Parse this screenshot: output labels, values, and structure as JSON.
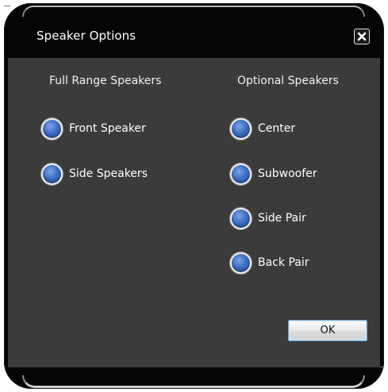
{
  "window": {
    "title": "Speaker Options",
    "close_icon": "close-icon"
  },
  "columns": {
    "full_range": {
      "heading": "Full Range Speakers",
      "options": [
        {
          "label": "Front Speaker"
        },
        {
          "label": "Side Speakers"
        }
      ]
    },
    "optional": {
      "heading": "Optional Speakers",
      "options": [
        {
          "label": "Center"
        },
        {
          "label": "Subwoofer"
        },
        {
          "label": "Side Pair"
        },
        {
          "label": "Back Pair"
        }
      ]
    }
  },
  "buttons": {
    "ok_label": "OK"
  },
  "colors": {
    "background": "#3b3b3b",
    "titlebar": "#050505",
    "radio_fill": "#3d6fc4",
    "ok_border": "#6fa6d8"
  }
}
